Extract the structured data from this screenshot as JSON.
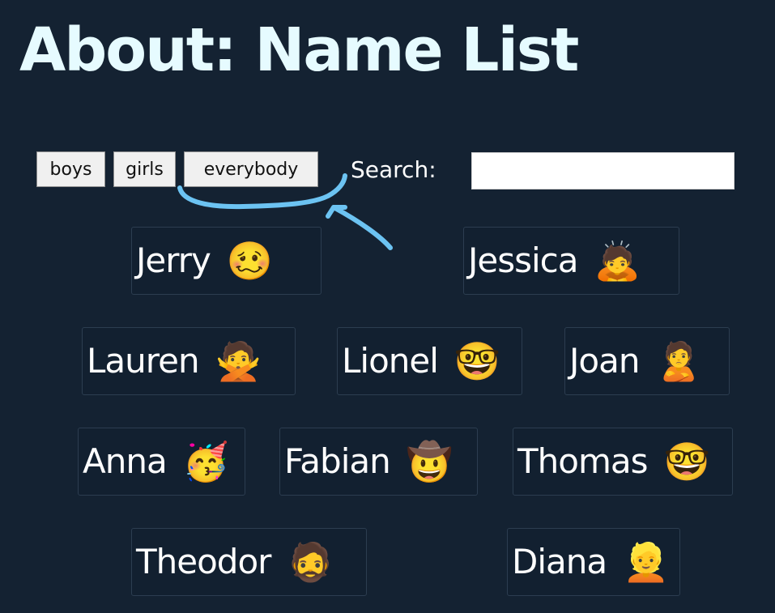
{
  "page": {
    "title": "About: Name List"
  },
  "filters": {
    "boys_label": "boys",
    "girls_label": "girls",
    "everybody_label": "everybody"
  },
  "search": {
    "label": "Search:",
    "value": "",
    "placeholder": ""
  },
  "people": [
    {
      "name": "Jerry",
      "emoji": "🥴",
      "emoji_name": "woozy-face-icon"
    },
    {
      "name": "Jessica",
      "emoji": "🙇",
      "emoji_name": "person-bowing-icon"
    },
    {
      "name": "Lauren",
      "emoji": "🙅",
      "emoji_name": "person-gesturing-no-icon"
    },
    {
      "name": "Lionel",
      "emoji": "🤓",
      "emoji_name": "nerd-face-icon"
    },
    {
      "name": "Joan",
      "emoji": "🙎",
      "emoji_name": "person-pouting-icon"
    },
    {
      "name": "Anna",
      "emoji": "🥳",
      "emoji_name": "partying-face-icon"
    },
    {
      "name": "Fabian",
      "emoji": "🤠",
      "emoji_name": "cowboy-face-icon"
    },
    {
      "name": "Thomas",
      "emoji": "🤓",
      "emoji_name": "nerd-face-icon"
    },
    {
      "name": "Theodor",
      "emoji": "🧔",
      "emoji_name": "bearded-person-icon"
    },
    {
      "name": "Diana",
      "emoji": "👱",
      "emoji_name": "blond-person-icon"
    }
  ],
  "colors": {
    "background": "#142232",
    "title": "#e6fbff",
    "annotation_arrow": "#6cc3f2",
    "card_border": "#2c3d50"
  }
}
